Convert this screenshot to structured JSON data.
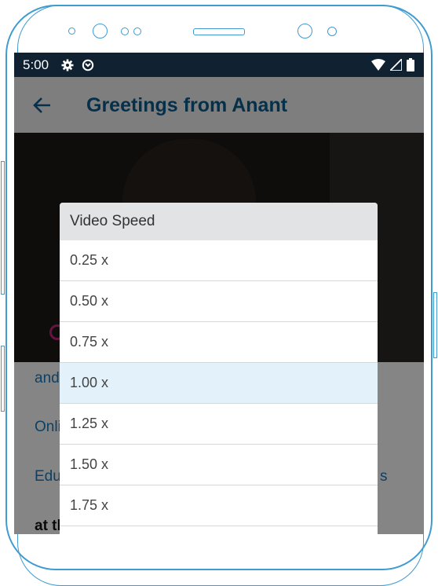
{
  "status_bar": {
    "time": "5:00"
  },
  "app_bar": {
    "title": "Greetings from Anant"
  },
  "content_fragments": {
    "line1": "and",
    "line2": "Onli",
    "line3": "Edu",
    "line3_right": "s",
    "line4": "at th"
  },
  "dialog": {
    "title": "Video Speed",
    "options": [
      "0.25 x",
      "0.50 x",
      "0.75 x",
      "1.00 x",
      "1.25 x",
      "1.50 x",
      "1.75 x"
    ],
    "selected": "1.00 x"
  },
  "colors": {
    "status_bar": "#102131",
    "accent": "#0b5c8f",
    "link": "#1b7bbd",
    "selected_row": "#e3f1fa",
    "frame": "#3f9bd0"
  }
}
